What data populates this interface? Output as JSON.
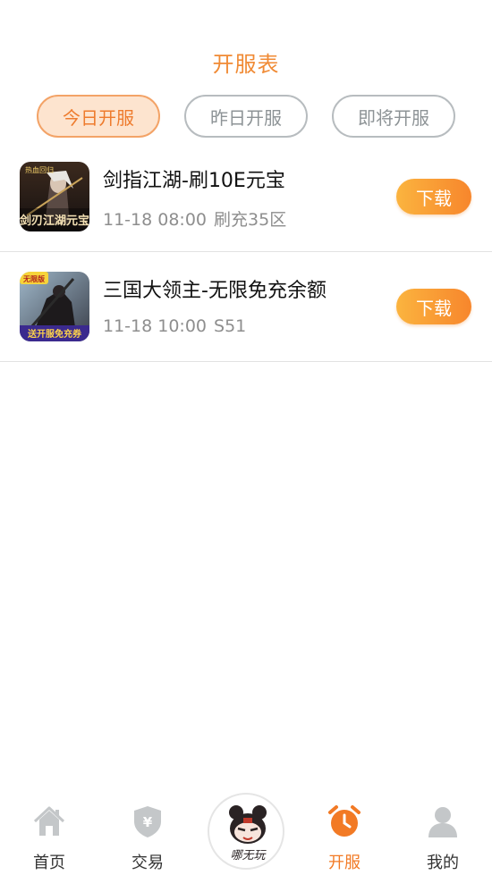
{
  "header": {
    "title": "开服表"
  },
  "tabs": [
    {
      "label": "今日开服",
      "active": true
    },
    {
      "label": "昨日开服",
      "active": false
    },
    {
      "label": "即将开服",
      "active": false
    }
  ],
  "games": [
    {
      "name": "剑指江湖-刷10E元宝",
      "datetime": "11-18 08:00",
      "server": "刷充35区",
      "button": "下载",
      "icon_text": "剑刃江湖元宝",
      "icon_badge": "热血回归"
    },
    {
      "name": "三国大领主-无限免充余额",
      "datetime": "11-18 10:00",
      "server": "S51",
      "button": "下载",
      "icon_badge": "无限版",
      "icon_banner": "送开服免充券"
    }
  ],
  "tabbar": {
    "items": [
      {
        "label": "首页",
        "icon": "home-icon",
        "active": false
      },
      {
        "label": "交易",
        "icon": "shield-yen-icon",
        "active": false
      },
      {
        "label": "",
        "icon": "center-logo",
        "active": false,
        "logo_text": "哪无玩"
      },
      {
        "label": "开服",
        "icon": "alarm-clock-icon",
        "active": true
      },
      {
        "label": "我的",
        "icon": "user-icon",
        "active": false
      }
    ]
  },
  "colors": {
    "accent": "#f27a25",
    "tab_active_bg": "#fde4cf",
    "inactive_icon": "#c4c7c9"
  }
}
